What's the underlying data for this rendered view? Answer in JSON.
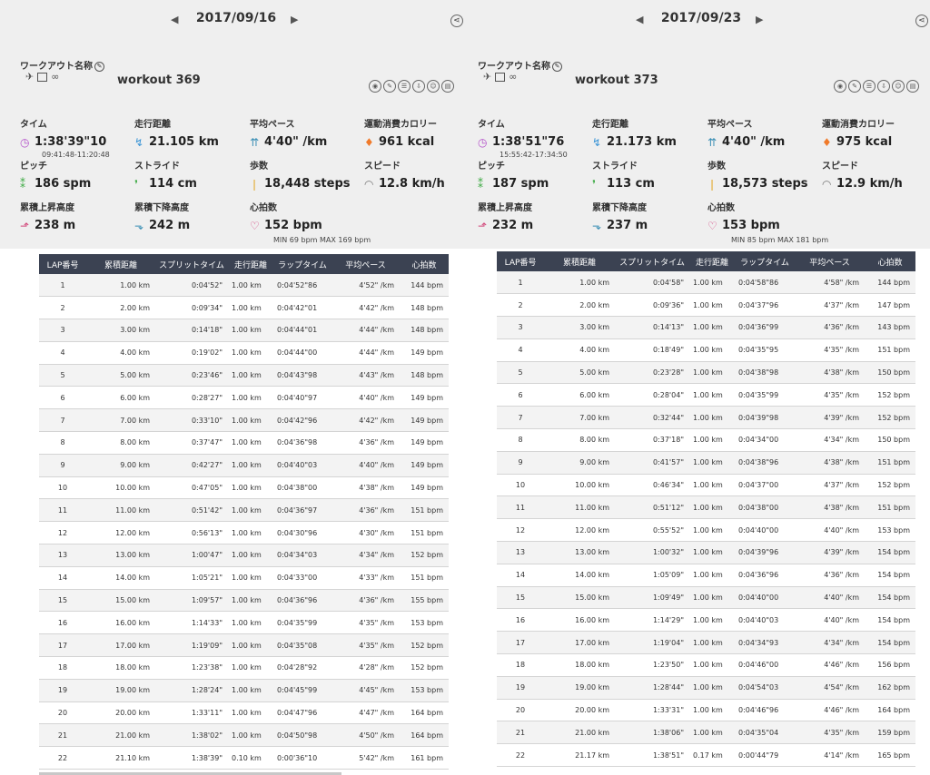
{
  "workouts": [
    {
      "date": "2017/09/16",
      "name_label": "ワークアウト名称",
      "name": "workout 369",
      "stats": {
        "time": {
          "label": "タイム",
          "value": "1:38'39\"10",
          "sub": "09:41:48-11:20:48"
        },
        "distance": {
          "label": "走行距離",
          "value": "21.105 km"
        },
        "pace": {
          "label": "平均ペース",
          "value": "4'40\" /km"
        },
        "calories": {
          "label": "運動消費カロリー",
          "value": "961 kcal"
        },
        "pitch": {
          "label": "ピッチ",
          "value": "186 spm"
        },
        "stride": {
          "label": "ストライド",
          "value": "114 cm"
        },
        "steps": {
          "label": "歩数",
          "value": "18,448 steps"
        },
        "speed": {
          "label": "スピード",
          "value": "12.8 km/h"
        },
        "ascent": {
          "label": "累積上昇高度",
          "value": "238 m"
        },
        "descent": {
          "label": "累積下降高度",
          "value": "242 m"
        },
        "heart": {
          "label": "心拍数",
          "value": "152 bpm",
          "sub": "MIN 69 bpm MAX 169 bpm"
        }
      },
      "table": {
        "headers": [
          "LAP番号",
          "累積距離",
          "スプリットタイム",
          "走行距離",
          "ラップタイム",
          "平均ペース",
          "心拍数"
        ],
        "rows": [
          [
            "1",
            "1.00 km",
            "0:04'52\"",
            "1.00 km",
            "0:04'52\"86",
            "4'52\" /km",
            "144 bpm"
          ],
          [
            "2",
            "2.00 km",
            "0:09'34\"",
            "1.00 km",
            "0:04'42\"01",
            "4'42\" /km",
            "148 bpm"
          ],
          [
            "3",
            "3.00 km",
            "0:14'18\"",
            "1.00 km",
            "0:04'44\"01",
            "4'44\" /km",
            "148 bpm"
          ],
          [
            "4",
            "4.00 km",
            "0:19'02\"",
            "1.00 km",
            "0:04'44\"00",
            "4'44\" /km",
            "149 bpm"
          ],
          [
            "5",
            "5.00 km",
            "0:23'46\"",
            "1.00 km",
            "0:04'43\"98",
            "4'43\" /km",
            "148 bpm"
          ],
          [
            "6",
            "6.00 km",
            "0:28'27\"",
            "1.00 km",
            "0:04'40\"97",
            "4'40\" /km",
            "149 bpm"
          ],
          [
            "7",
            "7.00 km",
            "0:33'10\"",
            "1.00 km",
            "0:04'42\"96",
            "4'42\" /km",
            "149 bpm"
          ],
          [
            "8",
            "8.00 km",
            "0:37'47\"",
            "1.00 km",
            "0:04'36\"98",
            "4'36\" /km",
            "149 bpm"
          ],
          [
            "9",
            "9.00 km",
            "0:42'27\"",
            "1.00 km",
            "0:04'40\"03",
            "4'40\" /km",
            "149 bpm"
          ],
          [
            "10",
            "10.00 km",
            "0:47'05\"",
            "1.00 km",
            "0:04'38\"00",
            "4'38\" /km",
            "149 bpm"
          ],
          [
            "11",
            "11.00 km",
            "0:51'42\"",
            "1.00 km",
            "0:04'36\"97",
            "4'36\" /km",
            "151 bpm"
          ],
          [
            "12",
            "12.00 km",
            "0:56'13\"",
            "1.00 km",
            "0:04'30\"96",
            "4'30\" /km",
            "151 bpm"
          ],
          [
            "13",
            "13.00 km",
            "1:00'47\"",
            "1.00 km",
            "0:04'34\"03",
            "4'34\" /km",
            "152 bpm"
          ],
          [
            "14",
            "14.00 km",
            "1:05'21\"",
            "1.00 km",
            "0:04'33\"00",
            "4'33\" /km",
            "151 bpm"
          ],
          [
            "15",
            "15.00 km",
            "1:09'57\"",
            "1.00 km",
            "0:04'36\"96",
            "4'36\" /km",
            "155 bpm"
          ],
          [
            "16",
            "16.00 km",
            "1:14'33\"",
            "1.00 km",
            "0:04'35\"99",
            "4'35\" /km",
            "153 bpm"
          ],
          [
            "17",
            "17.00 km",
            "1:19'09\"",
            "1.00 km",
            "0:04'35\"08",
            "4'35\" /km",
            "152 bpm"
          ],
          [
            "18",
            "18.00 km",
            "1:23'38\"",
            "1.00 km",
            "0:04'28\"92",
            "4'28\" /km",
            "152 bpm"
          ],
          [
            "19",
            "19.00 km",
            "1:28'24\"",
            "1.00 km",
            "0:04'45\"99",
            "4'45\" /km",
            "153 bpm"
          ],
          [
            "20",
            "20.00 km",
            "1:33'11\"",
            "1.00 km",
            "0:04'47\"96",
            "4'47\" /km",
            "164 bpm"
          ],
          [
            "21",
            "21.00 km",
            "1:38'02\"",
            "1.00 km",
            "0:04'50\"98",
            "4'50\" /km",
            "164 bpm"
          ],
          [
            "22",
            "21.10 km",
            "1:38'39\"",
            "0.10 km",
            "0:00'36\"10",
            "5'42\" /km",
            "161 bpm"
          ]
        ]
      }
    },
    {
      "date": "2017/09/23",
      "name_label": "ワークアウト名称",
      "name": "workout 373",
      "stats": {
        "time": {
          "label": "タイム",
          "value": "1:38'51\"76",
          "sub": "15:55:42-17:34:50"
        },
        "distance": {
          "label": "走行距離",
          "value": "21.173 km"
        },
        "pace": {
          "label": "平均ペース",
          "value": "4'40\" /km"
        },
        "calories": {
          "label": "運動消費カロリー",
          "value": "975 kcal"
        },
        "pitch": {
          "label": "ピッチ",
          "value": "187 spm"
        },
        "stride": {
          "label": "ストライド",
          "value": "113 cm"
        },
        "steps": {
          "label": "歩数",
          "value": "18,573 steps"
        },
        "speed": {
          "label": "スピード",
          "value": "12.9 km/h"
        },
        "ascent": {
          "label": "累積上昇高度",
          "value": "232 m"
        },
        "descent": {
          "label": "累積下降高度",
          "value": "237 m"
        },
        "heart": {
          "label": "心拍数",
          "value": "153 bpm",
          "sub": "MIN 85 bpm MAX 181 bpm"
        }
      },
      "table": {
        "headers": [
          "LAP番号",
          "累積距離",
          "スプリットタイム",
          "走行距離",
          "ラップタイム",
          "平均ペース",
          "心拍数"
        ],
        "rows": [
          [
            "1",
            "1.00 km",
            "0:04'58\"",
            "1.00 km",
            "0:04'58\"86",
            "4'58\" /km",
            "144 bpm"
          ],
          [
            "2",
            "2.00 km",
            "0:09'36\"",
            "1.00 km",
            "0:04'37\"96",
            "4'37\" /km",
            "147 bpm"
          ],
          [
            "3",
            "3.00 km",
            "0:14'13\"",
            "1.00 km",
            "0:04'36\"99",
            "4'36\" /km",
            "143 bpm"
          ],
          [
            "4",
            "4.00 km",
            "0:18'49\"",
            "1.00 km",
            "0:04'35\"95",
            "4'35\" /km",
            "151 bpm"
          ],
          [
            "5",
            "5.00 km",
            "0:23'28\"",
            "1.00 km",
            "0:04'38\"98",
            "4'38\" /km",
            "150 bpm"
          ],
          [
            "6",
            "6.00 km",
            "0:28'04\"",
            "1.00 km",
            "0:04'35\"99",
            "4'35\" /km",
            "152 bpm"
          ],
          [
            "7",
            "7.00 km",
            "0:32'44\"",
            "1.00 km",
            "0:04'39\"98",
            "4'39\" /km",
            "152 bpm"
          ],
          [
            "8",
            "8.00 km",
            "0:37'18\"",
            "1.00 km",
            "0:04'34\"00",
            "4'34\" /km",
            "150 bpm"
          ],
          [
            "9",
            "9.00 km",
            "0:41'57\"",
            "1.00 km",
            "0:04'38\"96",
            "4'38\" /km",
            "151 bpm"
          ],
          [
            "10",
            "10.00 km",
            "0:46'34\"",
            "1.00 km",
            "0:04'37\"00",
            "4'37\" /km",
            "152 bpm"
          ],
          [
            "11",
            "11.00 km",
            "0:51'12\"",
            "1.00 km",
            "0:04'38\"00",
            "4'38\" /km",
            "151 bpm"
          ],
          [
            "12",
            "12.00 km",
            "0:55'52\"",
            "1.00 km",
            "0:04'40\"00",
            "4'40\" /km",
            "153 bpm"
          ],
          [
            "13",
            "13.00 km",
            "1:00'32\"",
            "1.00 km",
            "0:04'39\"96",
            "4'39\" /km",
            "154 bpm"
          ],
          [
            "14",
            "14.00 km",
            "1:05'09\"",
            "1.00 km",
            "0:04'36\"96",
            "4'36\" /km",
            "154 bpm"
          ],
          [
            "15",
            "15.00 km",
            "1:09'49\"",
            "1.00 km",
            "0:04'40\"00",
            "4'40\" /km",
            "154 bpm"
          ],
          [
            "16",
            "16.00 km",
            "1:14'29\"",
            "1.00 km",
            "0:04'40\"03",
            "4'40\" /km",
            "154 bpm"
          ],
          [
            "17",
            "17.00 km",
            "1:19'04\"",
            "1.00 km",
            "0:04'34\"93",
            "4'34\" /km",
            "154 bpm"
          ],
          [
            "18",
            "18.00 km",
            "1:23'50\"",
            "1.00 km",
            "0:04'46\"00",
            "4'46\" /km",
            "156 bpm"
          ],
          [
            "19",
            "19.00 km",
            "1:28'44\"",
            "1.00 km",
            "0:04'54\"03",
            "4'54\" /km",
            "162 bpm"
          ],
          [
            "20",
            "20.00 km",
            "1:33'31\"",
            "1.00 km",
            "0:04'46\"96",
            "4'46\" /km",
            "164 bpm"
          ],
          [
            "21",
            "21.00 km",
            "1:38'06\"",
            "1.00 km",
            "0:04'35\"04",
            "4'35\" /km",
            "159 bpm"
          ],
          [
            "22",
            "21.17 km",
            "1:38'51\"",
            "0.17 km",
            "0:00'44\"79",
            "4'14\" /km",
            "165 bpm"
          ]
        ]
      }
    }
  ],
  "icons": {
    "prev": "◀",
    "next": "▶",
    "share": "⋖",
    "time": "◷",
    "distance": "↯",
    "pace": "⇈",
    "calories": "♦",
    "pitch": "⁑",
    "stride": "❜",
    "steps": "❘",
    "speed": "◠",
    "ascent": "⬏",
    "descent": "⬎",
    "heart": "♡"
  },
  "colors": {
    "header_bg": "#3b4252",
    "summary_bg": "#efefef",
    "time_icon": "#b34fc9",
    "distance_icon": "#3b95d6",
    "heart_icon": "#d23c7b"
  }
}
